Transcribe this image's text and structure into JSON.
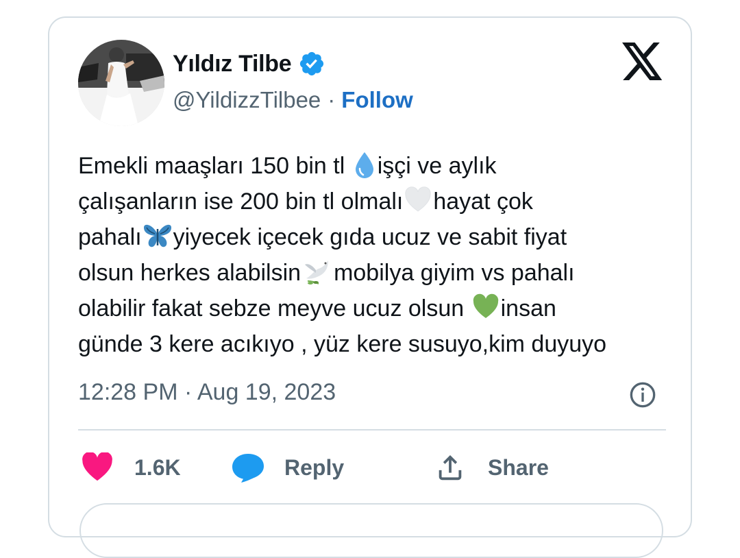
{
  "tweet": {
    "author": {
      "display_name": "Yıldız Tilbe",
      "handle": "@YildizzTilbee",
      "separator": "·",
      "follow_label": "Follow",
      "verified_color": "#1d9bf0"
    },
    "text_lines": [
      [
        "Emekli maaşları 150 bin tl ",
        "droplet",
        "işçi ve aylık"
      ],
      [
        "çalışanların ise 200 bin tl olmalı",
        "white-heart",
        "hayat çok"
      ],
      [
        "pahalı",
        "butterfly",
        "yiyecek içecek gıda ucuz ve sabit fiyat"
      ],
      [
        "olsun herkes alabilsin",
        "dove",
        "mobilya giyim vs pahalı"
      ],
      [
        "olabilir fakat sebze meyve ucuz olsun ",
        "green-heart",
        "insan"
      ],
      [
        "günde 3 kere acıkıyo , yüz kere susuyo,kim duyuyo",
        "",
        ""
      ]
    ],
    "line1_before": "Emekli maaşları 150 bin tl ",
    "line1_after": "işçi ve aylık",
    "line2_before": "çalışanların ise 200 bin tl olmalı",
    "line2_after": "hayat çok",
    "line3_before": "pahalı",
    "line3_after": "yiyecek içecek gıda ucuz ve sabit fiyat",
    "line4_before": "olsun herkes alabilsin",
    "line4_after": "mobilya giyim vs pahalı",
    "line5_before": "olabilir fakat sebze meyve ucuz olsun ",
    "line5_after": "insan",
    "line6": "günde 3 kere acıkıyo , yüz kere susuyo,kim duyuyo",
    "timestamp": "12:28 PM · Aug 19, 2023"
  },
  "actions": {
    "like_count": "1.6K",
    "reply_label": "Reply",
    "share_label": "Share"
  },
  "icons": {
    "x_logo": "x-logo-icon",
    "verified": "verified-badge-icon",
    "info": "info-icon",
    "like": "heart-icon",
    "reply": "reply-bubble-icon",
    "share": "share-icon"
  },
  "colors": {
    "text": "#0f1419",
    "secondary": "#536471",
    "link": "#1d6fc4",
    "like": "#f91880",
    "reply": "#1d9bf0",
    "border": "#d4dde3"
  }
}
